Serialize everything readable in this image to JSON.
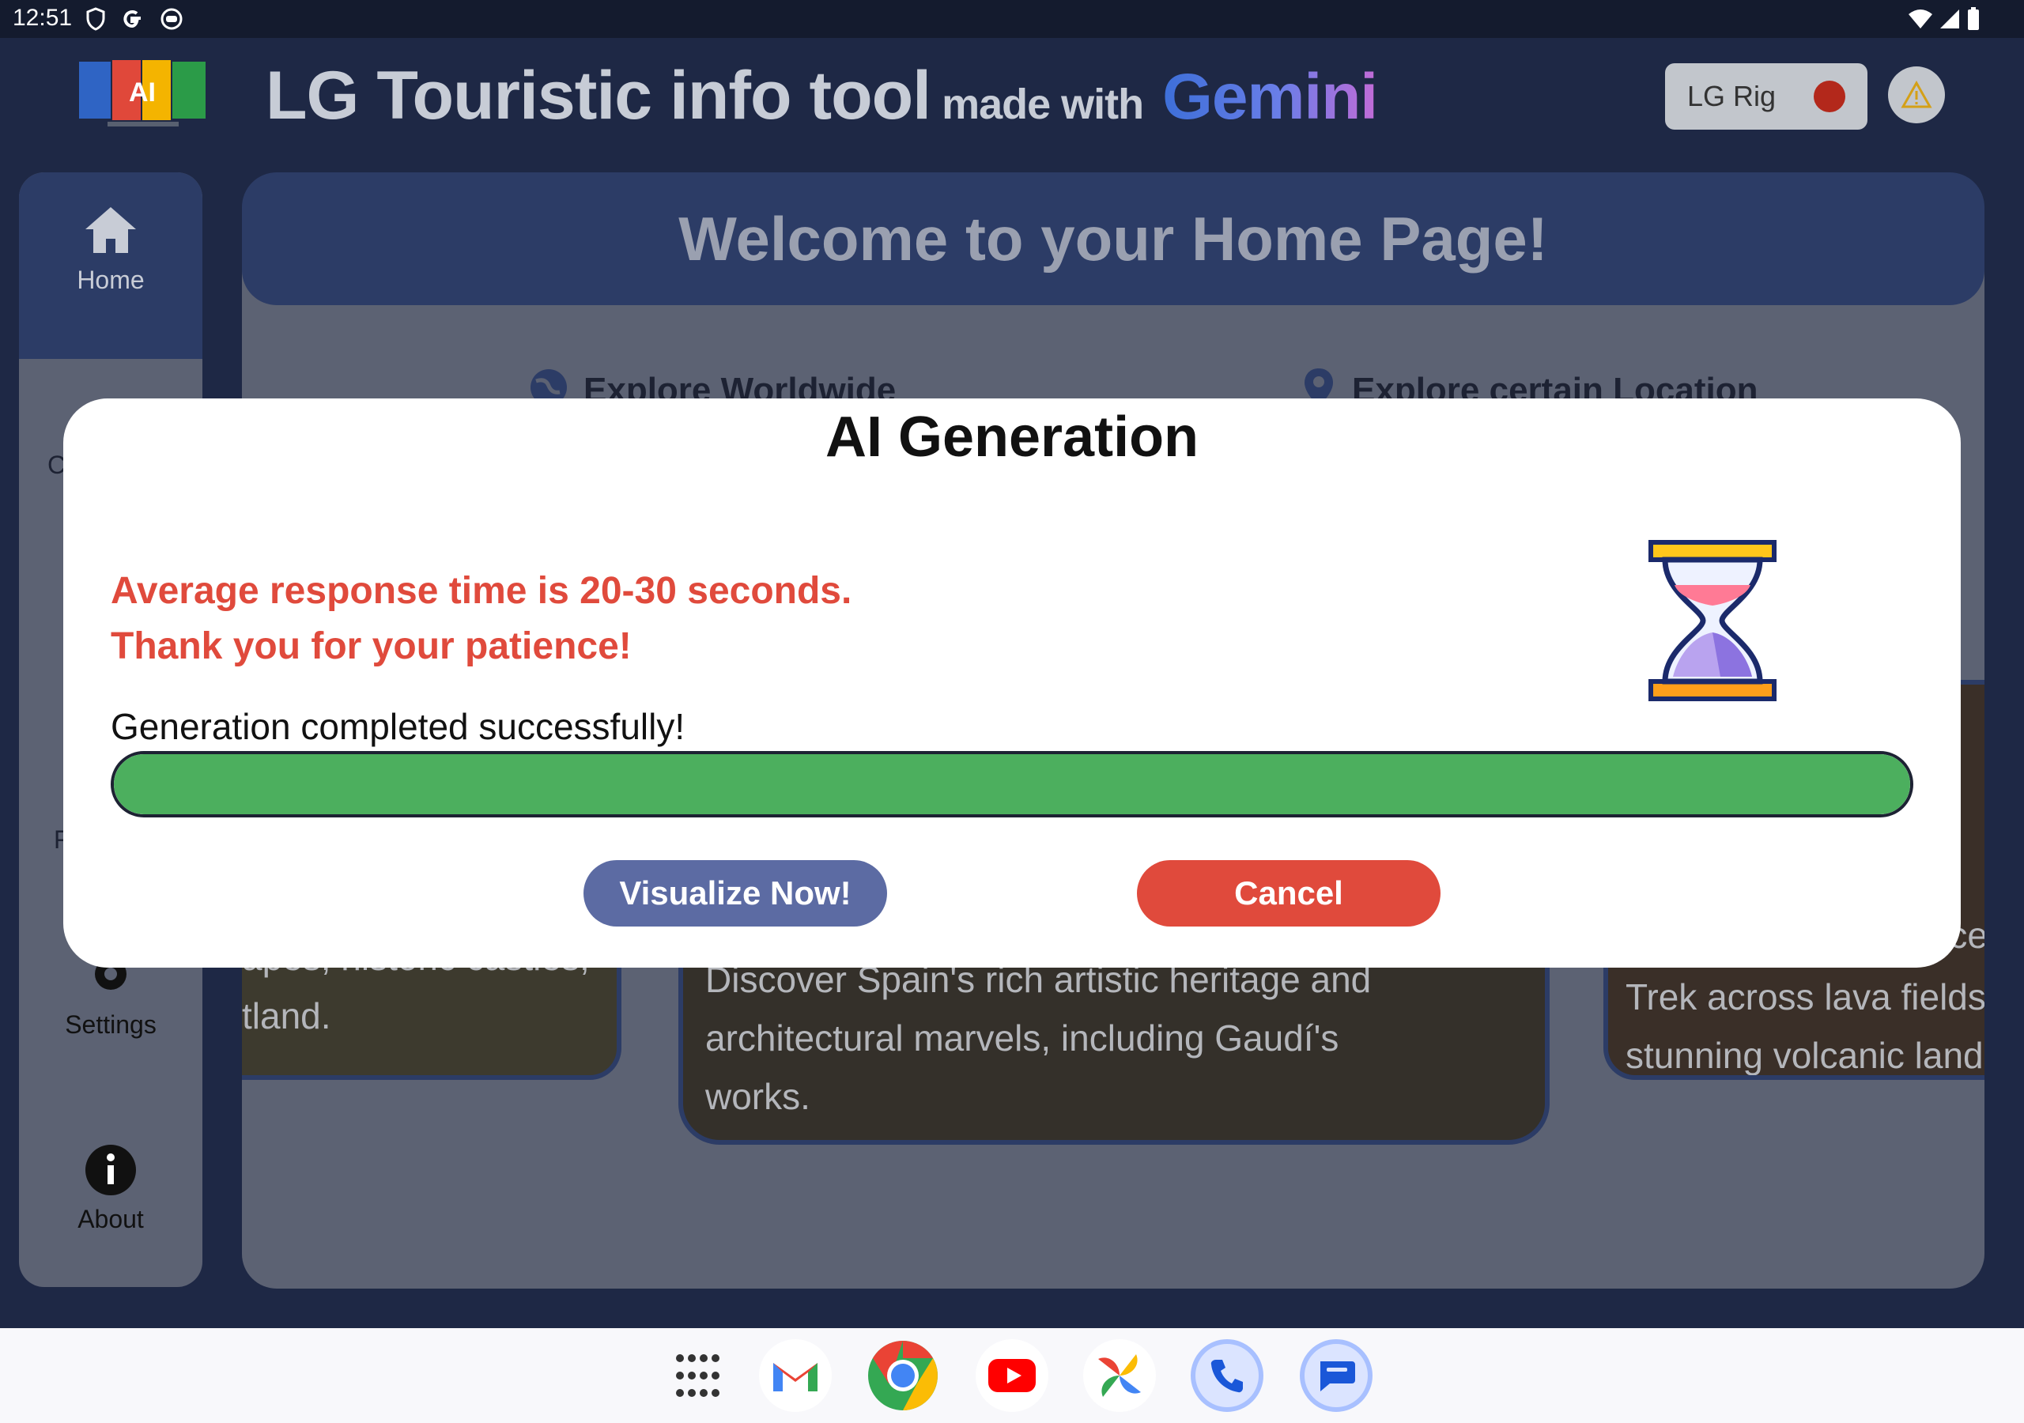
{
  "status_bar": {
    "time": "12:51",
    "left_icons": [
      "shield-icon",
      "google-g-icon",
      "android-face-icon"
    ],
    "right_icons": [
      "wifi-icon",
      "signal-icon",
      "battery-icon"
    ]
  },
  "header": {
    "logo_icon": "ai-tourism-logo-icon",
    "title": "LG Touristic info tool",
    "subtitle": "made with",
    "brand": "Gemini",
    "lg_rig_label": "LG Rig",
    "lg_rig_status_color": "#b3281b",
    "warning_icon": "warning-triangle-icon"
  },
  "sidebar": {
    "items": [
      {
        "label": "Home",
        "icon": "home-icon",
        "active": true
      },
      {
        "label": "Settings",
        "icon": "gear-icon"
      },
      {
        "label": "About",
        "icon": "info-icon"
      }
    ],
    "partial_letters": [
      "C",
      "F"
    ]
  },
  "main": {
    "welcome": "Welcome to your Home Page!",
    "sections": [
      {
        "label": "Explore Worldwide",
        "icon": "globe-icon"
      },
      {
        "label": "Explore certain Location",
        "icon": "location-pin-icon"
      }
    ],
    "cards": [
      {
        "lines": [
          "apes, historic castles,",
          "tland."
        ]
      },
      {
        "lines": [
          "Discover Spain's rich artistic heritage and",
          "architectural marvels, including Gaudí's",
          "works."
        ]
      },
      {
        "lines": [
          "Trek across lava fields,",
          "stunning volcanic lands"
        ],
        "title_fragment": "ce"
      }
    ]
  },
  "dialog": {
    "title": "AI Generation",
    "notice_line1": "Average response time is 20-30 seconds.",
    "notice_line2": "Thank you for your patience!",
    "status": "Generation completed successfully!",
    "progress": 1.0,
    "progress_color": "#4caf5e",
    "visualize_label": "Visualize Now!",
    "cancel_label": "Cancel",
    "hourglass_icon": "hourglass-icon"
  },
  "taskbar": {
    "apps": [
      "app-drawer-icon",
      "gmail-icon",
      "chrome-icon",
      "youtube-icon",
      "photos-icon",
      "phone-icon",
      "messages-icon"
    ]
  }
}
